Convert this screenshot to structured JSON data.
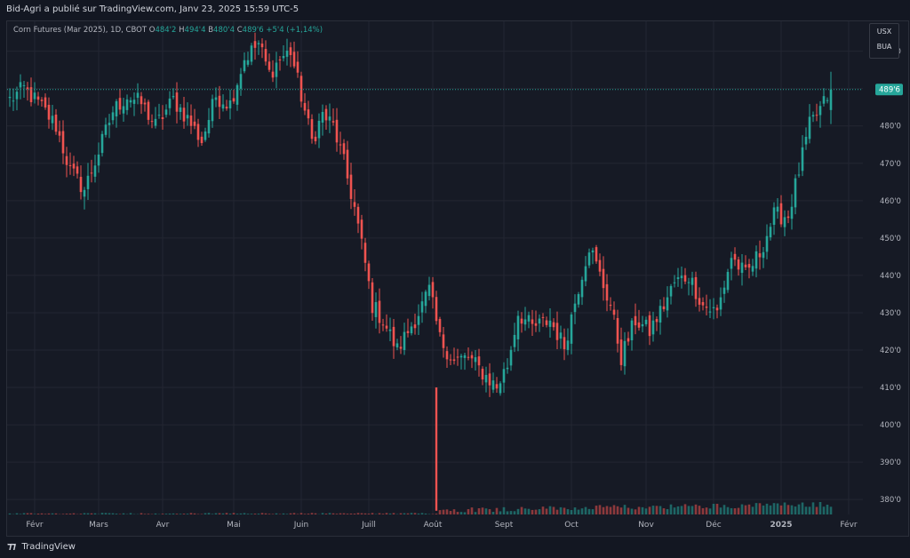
{
  "header": {
    "attribution": "Bid-Agri a publié sur TradingView.com, Janv 23, 2025 15:59 UTC-5"
  },
  "legend": {
    "symbol": "Corn Futures (Mar 2025), 1D, CBOT",
    "open_label": "O",
    "open": "484'2",
    "high_label": "H",
    "high": "494'4",
    "low_label": "B",
    "low": "480'4",
    "close_label": "C",
    "close": "489'6",
    "change": "+5'4 (+1,14%)"
  },
  "currency": {
    "unit": "USX",
    "sub": "BUA"
  },
  "footer": {
    "brand": "TradingView"
  },
  "colors": {
    "up": "#26a69a",
    "down": "#ef5350",
    "grid": "#232632",
    "last_price_label": "#26a69a"
  },
  "chart_data": {
    "type": "candlestick",
    "last_price": 489.75,
    "last_price_label": "489'6",
    "y_range": [
      376,
      508
    ],
    "y_ticks": [
      {
        "v": 500,
        "label": "500'0"
      },
      {
        "v": 490,
        "label": "490'0"
      },
      {
        "v": 480,
        "label": "480'0"
      },
      {
        "v": 470,
        "label": "470'0"
      },
      {
        "v": 460,
        "label": "460'0"
      },
      {
        "v": 450,
        "label": "450'0"
      },
      {
        "v": 440,
        "label": "440'0"
      },
      {
        "v": 430,
        "label": "430'0"
      },
      {
        "v": 420,
        "label": "420'0"
      },
      {
        "v": 410,
        "label": "410'0"
      },
      {
        "v": 400,
        "label": "400'0"
      },
      {
        "v": 390,
        "label": "390'0"
      },
      {
        "v": 380,
        "label": "380'0"
      }
    ],
    "x_ticks": [
      {
        "i": 7,
        "label": "Févr"
      },
      {
        "i": 25,
        "label": "Mars"
      },
      {
        "i": 43,
        "label": "Avr"
      },
      {
        "i": 63,
        "label": "Mai"
      },
      {
        "i": 82,
        "label": "Juin"
      },
      {
        "i": 101,
        "label": "Juill"
      },
      {
        "i": 119,
        "label": "Août"
      },
      {
        "i": 139,
        "label": "Sept"
      },
      {
        "i": 158,
        "label": "Oct"
      },
      {
        "i": 179,
        "label": "Nov"
      },
      {
        "i": 198,
        "label": "Déc"
      },
      {
        "i": 217,
        "label": "2025"
      },
      {
        "i": 236,
        "label": "Févr"
      }
    ],
    "x_domain": [
      0,
      240
    ],
    "anchors": [
      [
        0,
        487
      ],
      [
        4,
        490
      ],
      [
        9,
        485
      ],
      [
        13,
        480
      ],
      [
        17,
        468
      ],
      [
        21,
        463
      ],
      [
        25,
        473
      ],
      [
        29,
        484
      ],
      [
        33,
        488
      ],
      [
        37,
        486
      ],
      [
        41,
        480
      ],
      [
        46,
        487
      ],
      [
        50,
        482
      ],
      [
        54,
        476
      ],
      [
        58,
        488
      ],
      [
        62,
        486
      ],
      [
        66,
        498
      ],
      [
        70,
        502
      ],
      [
        73,
        494
      ],
      [
        76,
        498
      ],
      [
        79,
        500
      ],
      [
        82,
        488
      ],
      [
        85,
        476
      ],
      [
        88,
        483
      ],
      [
        91,
        480
      ],
      [
        94,
        470
      ],
      [
        97,
        458
      ],
      [
        100,
        443
      ],
      [
        102,
        432
      ],
      [
        105,
        428
      ],
      [
        109,
        420
      ],
      [
        112,
        425
      ],
      [
        115,
        430
      ],
      [
        118,
        436
      ],
      [
        121,
        423
      ],
      [
        125,
        417
      ],
      [
        129,
        418
      ],
      [
        133,
        414
      ],
      [
        137,
        410
      ],
      [
        140,
        416
      ],
      [
        143,
        430
      ],
      [
        147,
        426
      ],
      [
        152,
        428
      ],
      [
        156,
        421
      ],
      [
        160,
        437
      ],
      [
        163,
        448
      ],
      [
        166,
        440
      ],
      [
        169,
        432
      ],
      [
        172,
        418
      ],
      [
        176,
        428
      ],
      [
        180,
        425
      ],
      [
        184,
        432
      ],
      [
        187,
        438
      ],
      [
        191,
        440
      ],
      [
        195,
        432
      ],
      [
        199,
        430
      ],
      [
        203,
        445
      ],
      [
        207,
        440
      ],
      [
        211,
        446
      ],
      [
        215,
        456
      ],
      [
        219,
        456
      ],
      [
        222,
        468
      ],
      [
        225,
        480
      ],
      [
        229,
        486
      ],
      [
        231,
        489.75
      ]
    ],
    "spike": {
      "i": 120,
      "low": 377,
      "high": 410
    },
    "candles": [],
    "volume": []
  }
}
